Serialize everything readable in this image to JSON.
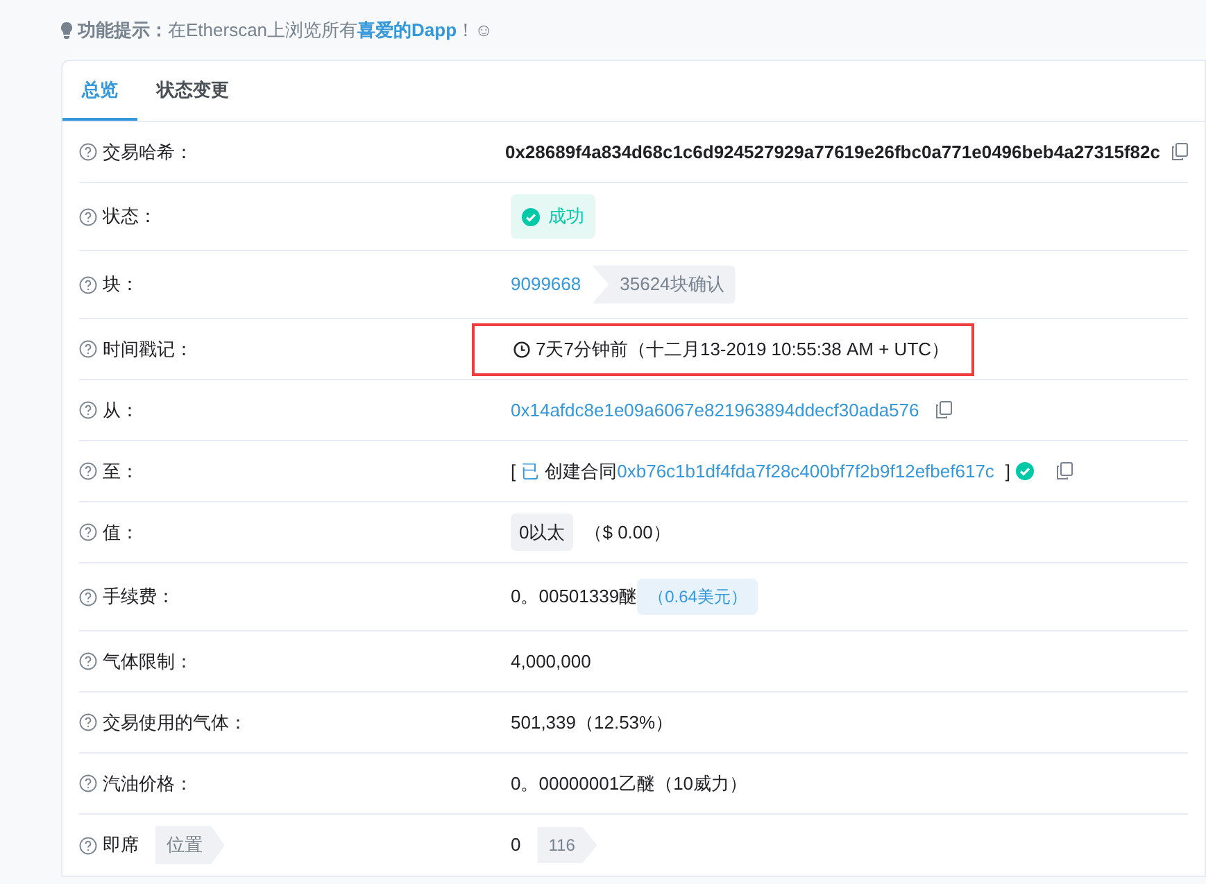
{
  "tip": {
    "label": "功能提示：",
    "text": "在Etherscan上浏览所有",
    "link": "喜爱的Dapp",
    "end": "！☺"
  },
  "tabs": [
    {
      "label": "总览",
      "selected": true
    },
    {
      "label": "状态变更",
      "selected": false
    }
  ],
  "rows": [
    {
      "kind": "hash",
      "label": "交易哈希：",
      "highlighted": false,
      "value": "0x28689f4a834d68c1c6d924527929a77619e26fbc0a771e0496beb4a27315f82c"
    },
    {
      "kind": "status",
      "label": "状态：",
      "highlighted": false,
      "value": "成功"
    },
    {
      "kind": "block",
      "label": "块：",
      "highlighted": false,
      "value": "9099668",
      "badge": "35624块确认"
    },
    {
      "kind": "time",
      "label": "时间戳记：",
      "highlighted": true,
      "value": "7天7分钟前（十二月13-2019 10:55:38 AM + UTC）"
    },
    {
      "kind": "address",
      "label": "从：",
      "highlighted": false,
      "value": "0x14afdc8e1e09a6067e821963894ddecf30ada576"
    },
    {
      "kind": "contract",
      "label": "至：",
      "highlighted": false,
      "open": "[",
      "created": "已",
      "action": "创建合同",
      "value": "0xb76c1b1df4fda7f28c400bf7f2b9f12efbef617c",
      "close": "]"
    },
    {
      "kind": "value",
      "label": "值：",
      "highlighted": false,
      "badge": "0以太",
      "value": "（$ 0.00）"
    },
    {
      "kind": "fee",
      "label": "手续费：",
      "highlighted": false,
      "value": "0。00501339醚",
      "badge": "（0.64美元）"
    },
    {
      "kind": "plain",
      "label": "气体限制：",
      "highlighted": false,
      "value": "4,000,000"
    },
    {
      "kind": "plain",
      "label": "交易使用的气体：",
      "highlighted": false,
      "value": "501,339（12.53%）"
    },
    {
      "kind": "plain",
      "label": "汽油价格：",
      "highlighted": false,
      "value": "0。00000001乙醚（10威力）"
    },
    {
      "kind": "nonce",
      "label": "即席",
      "tag": "位置",
      "highlighted": false,
      "value": "0",
      "badge": "116"
    }
  ]
}
